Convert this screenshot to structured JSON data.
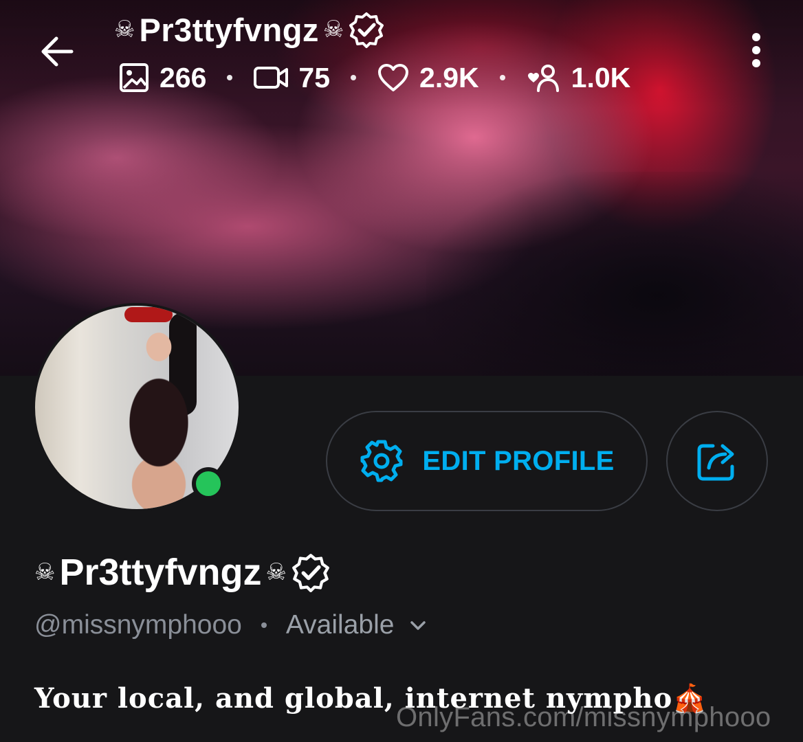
{
  "header": {
    "name": "Pr3ttyfvngz",
    "decoration": "☠",
    "stats": {
      "photos": "266",
      "videos": "75",
      "likes": "2.9K",
      "fans": "1.0K"
    }
  },
  "profile": {
    "name": "Pr3ttyfvngz",
    "decoration": "☠",
    "handle": "@missnymphooo",
    "status": "Available",
    "bio": "Your local, and global, internet nympho",
    "bio_emoji": "🎪"
  },
  "actions": {
    "edit_label": "EDIT PROFILE"
  },
  "watermark": "OnlyFans.com/missnymphooo",
  "colors": {
    "accent": "#00aeef",
    "online": "#25c45a",
    "background": "#161618",
    "muted": "#8a8f98"
  },
  "icons": [
    "back-arrow-icon",
    "more-vert-icon",
    "verified-icon",
    "image-icon",
    "video-icon",
    "heart-icon",
    "fans-icon",
    "gear-icon",
    "share-icon",
    "chevron-down-icon"
  ]
}
